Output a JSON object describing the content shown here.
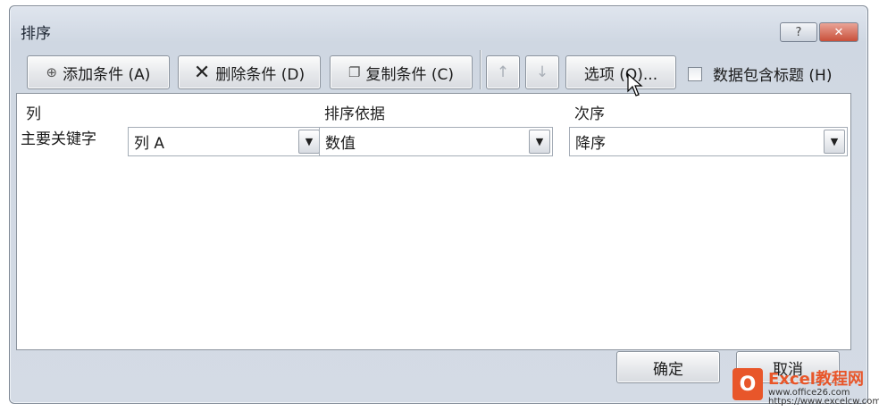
{
  "window": {
    "title": "排序",
    "help_label": "?",
    "close_label": "✕"
  },
  "toolbar": {
    "add_label": "添加条件 (A)",
    "delete_label": "删除条件 (D)",
    "copy_label": "复制条件 (C)",
    "move_up_label": "↑",
    "move_down_label": "↓",
    "options_label": "选项 (O)...",
    "header_checkbox_label": "数据包含标题 (H)"
  },
  "columns": {
    "column_header": "列",
    "sort_on_header": "排序依据",
    "order_header": "次序"
  },
  "rows": [
    {
      "label": "主要关键字",
      "column_value": "列 A",
      "sort_on_value": "数值",
      "order_value": "降序"
    }
  ],
  "footer": {
    "ok_label": "确定",
    "cancel_label": "取消"
  },
  "watermark": {
    "brand": "Excel教程网",
    "url": "www.office26.com",
    "site": "https://www.excelcw.com"
  }
}
